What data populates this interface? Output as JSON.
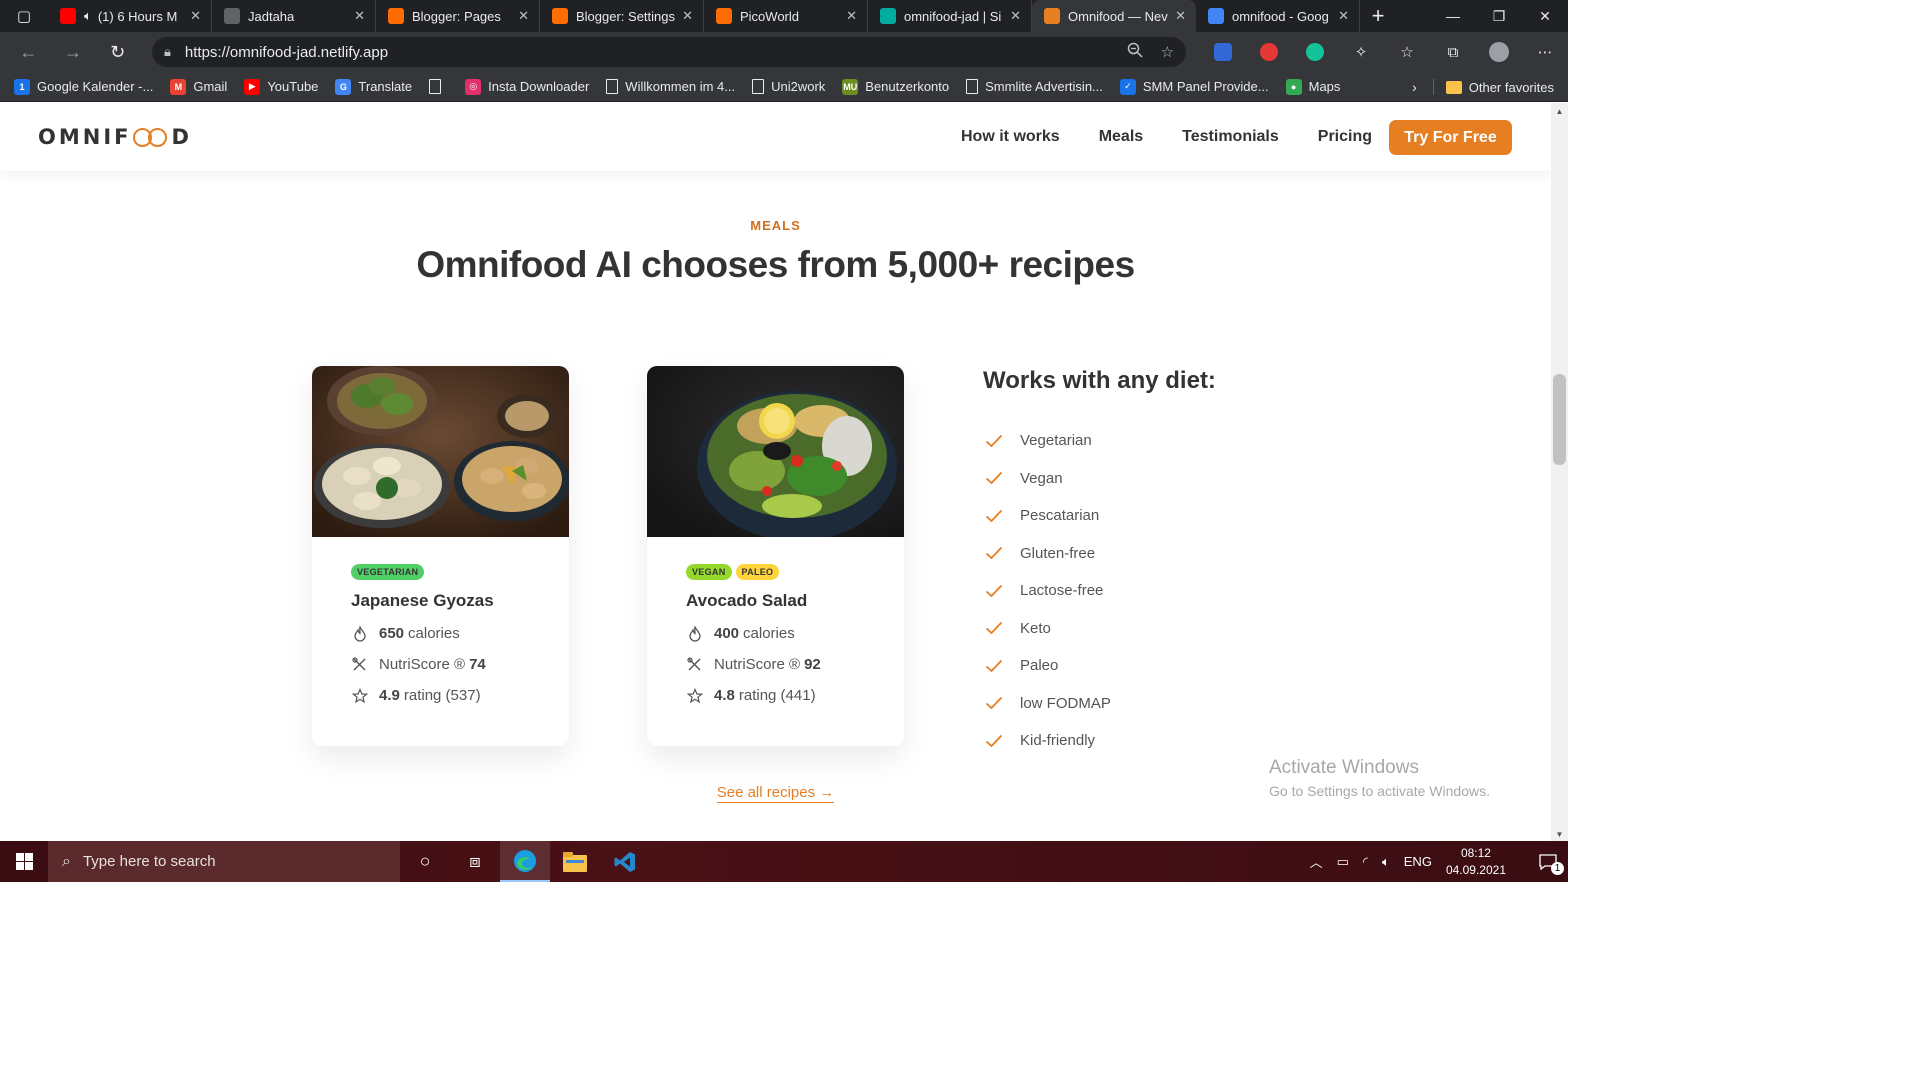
{
  "browser": {
    "tabs": [
      {
        "label": "(1) 6 Hours M",
        "favicon": "youtube-icon",
        "color": "#ff0000",
        "audio": true
      },
      {
        "label": "Jadtaha",
        "favicon": "page-icon",
        "color": "#5f6368"
      },
      {
        "label": "Blogger: Pages",
        "favicon": "blogger-icon",
        "color": "#ff6d00"
      },
      {
        "label": "Blogger: Settings",
        "favicon": "blogger-icon",
        "color": "#ff6d00"
      },
      {
        "label": "PicoWorld",
        "favicon": "blogger-icon",
        "color": "#ff6d00"
      },
      {
        "label": "omnifood-jad | Si",
        "favicon": "netlify-icon",
        "color": "#00ad9f"
      },
      {
        "label": "Omnifood — Nev",
        "favicon": "omnifood-icon",
        "color": "#e67e22",
        "active": true
      },
      {
        "label": "omnifood - Goog",
        "favicon": "google-icon",
        "color": "#4285f4"
      }
    ],
    "url": "https://omnifood-jad.netlify.app",
    "bookmarks": [
      {
        "label": "Google Kalender -...",
        "color": "#1a73e8",
        "icon": "1"
      },
      {
        "label": "Gmail",
        "color": "#ea4335",
        "icon": "M"
      },
      {
        "label": "YouTube",
        "color": "#ff0000",
        "icon": "▶"
      },
      {
        "label": "Translate",
        "color": "#4285f4",
        "icon": "G"
      },
      {
        "label": "",
        "color": "#5f6368",
        "icon": ""
      },
      {
        "label": "Insta Downloader",
        "color": "#e1306c",
        "icon": "◎"
      },
      {
        "label": "Willkommen im 4...",
        "color": "#5f6368",
        "icon": ""
      },
      {
        "label": "Uni2work",
        "color": "#1e8e3e",
        "icon": ""
      },
      {
        "label": "Benutzerkonto",
        "color": "#6b8e23",
        "icon": "MU"
      },
      {
        "label": "Smmlite Advertisin...",
        "color": "#35363a",
        "icon": ""
      },
      {
        "label": "SMM Panel Provide...",
        "color": "#1a73e8",
        "icon": "✓"
      },
      {
        "label": "Maps",
        "color": "#34a853",
        "icon": "●"
      }
    ],
    "other_favorites": "Other favorites"
  },
  "site": {
    "logo": {
      "pre": "OMNIF",
      "post": "D"
    },
    "nav": [
      "How it works",
      "Meals",
      "Testimonials",
      "Pricing"
    ],
    "cta": "Try For Free",
    "subheading": "MEALS",
    "heading": "Omnifood AI chooses from 5,000+ recipes",
    "meals": [
      {
        "tags": [
          {
            "label": "Vegetarian",
            "color": "#51cf66"
          }
        ],
        "title": "Japanese Gyozas",
        "calories": "650",
        "calories_label": "calories",
        "nutri_label": "NutriScore ®",
        "nutri": "74",
        "rating": "4.9",
        "rating_label": "rating (537)"
      },
      {
        "tags": [
          {
            "label": "Vegan",
            "color": "#94d82d"
          },
          {
            "label": "Paleo",
            "color": "#ffd43b"
          }
        ],
        "title": "Avocado Salad",
        "calories": "400",
        "calories_label": "calories",
        "nutri_label": "NutriScore ®",
        "nutri": "92",
        "rating": "4.8",
        "rating_label": "rating (441)"
      }
    ],
    "diet_title": "Works with any diet:",
    "diets": [
      "Vegetarian",
      "Vegan",
      "Pescatarian",
      "Gluten-free",
      "Lactose-free",
      "Keto",
      "Paleo",
      "low FODMAP",
      "Kid-friendly"
    ],
    "see_all": "See all recipes →",
    "accent_color": "#e67e22"
  },
  "watermark": {
    "line1": "Activate Windows",
    "line2": "Go to Settings to activate Windows."
  },
  "taskbar": {
    "search_placeholder": "Type here to search",
    "language": "ENG",
    "time": "08:12",
    "date": "04.09.2021",
    "notification_count": "1"
  }
}
